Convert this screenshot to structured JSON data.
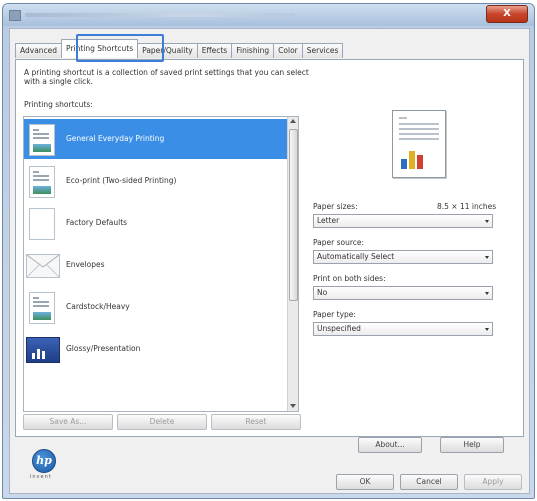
{
  "window": {
    "close_label": "X"
  },
  "tabs": [
    {
      "label": "Advanced"
    },
    {
      "label": "Printing Shortcuts",
      "active": true
    },
    {
      "label": "Paper/Quality"
    },
    {
      "label": "Effects"
    },
    {
      "label": "Finishing"
    },
    {
      "label": "Color"
    },
    {
      "label": "Services"
    }
  ],
  "description": "A printing shortcut is a collection of saved print settings that you can select with a single click.",
  "shortcuts_label": "Printing shortcuts:",
  "shortcuts": [
    {
      "label": "General Everyday Printing",
      "icon": "document-icon",
      "selected": true
    },
    {
      "label": "Eco-print (Two-sided Printing)",
      "icon": "duplex-document-icon"
    },
    {
      "label": "Factory Defaults",
      "icon": "blank-page-icon"
    },
    {
      "label": "Envelopes",
      "icon": "envelope-icon"
    },
    {
      "label": "Cardstock/Heavy",
      "icon": "cardstock-icon"
    },
    {
      "label": "Glossy/Presentation",
      "icon": "presentation-icon"
    }
  ],
  "list_buttons": {
    "save_as": "Save As...",
    "delete": "Delete",
    "reset": "Reset"
  },
  "paper_sizes": {
    "label": "Paper sizes:",
    "dimension": "8.5 × 11 inches",
    "value": "Letter"
  },
  "paper_source": {
    "label": "Paper source:",
    "value": "Automatically Select"
  },
  "print_both_sides": {
    "label": "Print on both sides:",
    "value": "No"
  },
  "paper_type": {
    "label": "Paper type:",
    "value": "Unspecified"
  },
  "about_label": "About...",
  "help_label": "Help",
  "logo": {
    "text": "hp",
    "tagline": "invent"
  },
  "footer": {
    "ok": "OK",
    "cancel": "Cancel",
    "apply": "Apply"
  }
}
